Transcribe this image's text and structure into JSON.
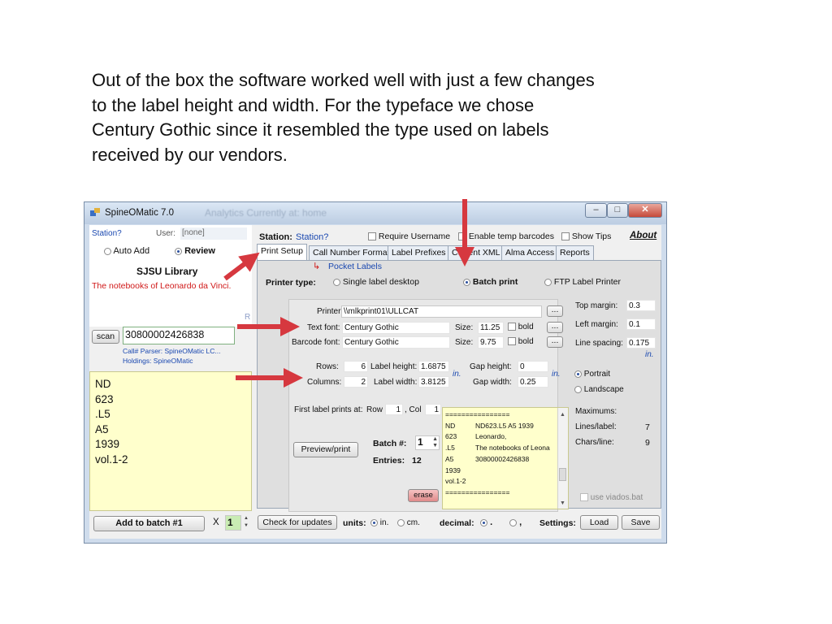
{
  "caption": [
    "Out of the box the software worked well with just a few changes",
    "to the label height and width. For the typeface we chose",
    "Century Gothic since it resembled the type used on labels",
    "received by our vendors."
  ],
  "window": {
    "title": "SpineOMatic 7.0",
    "ghost_title": "Analytics    Currently at: home",
    "controls": {
      "minimize": "–",
      "maximize": "□",
      "close": "✕"
    }
  },
  "left": {
    "station_small": "Station?",
    "user_label": "User:",
    "user_value": "[none]",
    "auto_add": "Auto Add",
    "review": "Review",
    "library": "SJSU Library",
    "book_title": "The notebooks of Leonardo da Vinci.",
    "letter_r": "R",
    "scan": "scan",
    "barcode": "30800002426838",
    "parser": "Call# Parser: SpineOMatic LC...",
    "holdings": "Holdings: SpineOMatic",
    "call_number": [
      "ND",
      "623",
      ".L5",
      "A5",
      "1939",
      "vol.1-2"
    ],
    "add_to_batch": "Add to batch #1",
    "x_label": "X",
    "batch_count": "1"
  },
  "top": {
    "station_label": "Station:",
    "station_value": "Station?",
    "require_username": "Require Username",
    "enable_temp": "Enable temp barcodes",
    "show_tips": "Show Tips",
    "about": "About"
  },
  "tabs": [
    "Print Setup",
    "Call Number Format",
    "Label Prefixes",
    "Current XML",
    "Alma Access",
    "Reports"
  ],
  "print_setup": {
    "pocket_labels": "Pocket Labels",
    "printer_type": "Printer type:",
    "single_label": "Single label desktop",
    "batch_print": "Batch print",
    "ftp_label": "FTP Label Printer",
    "printer_label": "Printer:",
    "printer_value": "\\\\mlkprint01\\ULLCAT",
    "text_font_label": "Text font:",
    "text_font_value": "Century Gothic",
    "barcode_font_label": "Barcode font:",
    "barcode_font_value": "Century Gothic",
    "size_label": "Size:",
    "text_size": "11.25",
    "barcode_size": "9.75",
    "bold_label": "bold",
    "ellipsis": "...",
    "rows_label": "Rows:",
    "rows_value": "6",
    "columns_label": "Columns:",
    "columns_value": "2",
    "label_height_label": "Label height:",
    "label_height_value": "1.6875",
    "label_width_label": "Label width:",
    "label_width_value": "3.8125",
    "gap_height_label": "Gap height:",
    "gap_height_value": "0",
    "gap_width_label": "Gap width:",
    "gap_width_value": "0.25",
    "in_label": "in.",
    "first_label": "First label prints at:",
    "row_label": "Row",
    "row_value": "1",
    "col_label": ", Col",
    "col_value": "1",
    "preview": "Preview/print",
    "batch_num_label": "Batch #:",
    "batch_num_value": "1",
    "entries_label": "Entries:",
    "entries_value": "12",
    "erase": "erase",
    "top_margin_label": "Top margin:",
    "top_margin_value": "0.3",
    "left_margin_label": "Left margin:",
    "left_margin_value": "0.1",
    "line_spacing_label": "Line spacing:",
    "line_spacing_value": "0.175",
    "portrait": "Portrait",
    "landscape": "Landscape",
    "maximums": "Maximums:",
    "lines_label": "Lines/label:",
    "lines_value": "7",
    "chars_label": "Chars/line:",
    "chars_value": "9",
    "use_viados": "use viados.bat",
    "xml_preview": [
      [
        "================",
        ""
      ],
      [
        "ND",
        "ND623.L5 A5 1939"
      ],
      [
        "623",
        "Leonardo,"
      ],
      [
        ".L5",
        "The notebooks of Leona"
      ],
      [
        "A5",
        "30800002426838"
      ],
      [
        "1939",
        ""
      ],
      [
        "vol.1-2",
        ""
      ],
      [
        "================",
        ""
      ]
    ]
  },
  "bottom": {
    "check_updates": "Check for updates",
    "units_label": "units:",
    "unit_in": "in.",
    "unit_cm": "cm.",
    "decimal_label": "decimal:",
    "dec_dot": ".",
    "dec_comma": ",",
    "settings_label": "Settings:",
    "load": "Load",
    "save": "Save"
  },
  "colors": {
    "arrow": "#d6383f",
    "link_blue": "#1a48b0",
    "title_red": "#d01818",
    "panel_yellow": "#ffffcc"
  }
}
